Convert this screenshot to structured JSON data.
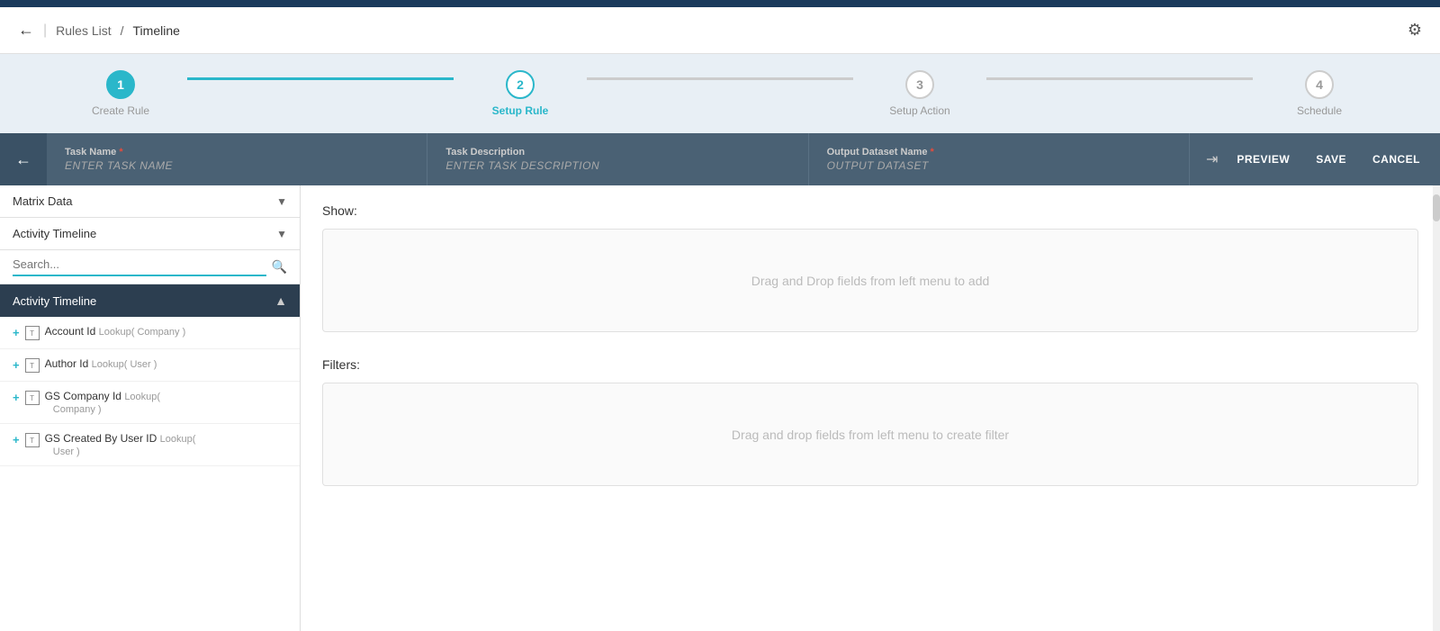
{
  "topNav": {
    "background": "#1a3a5c"
  },
  "breadcrumb": {
    "backLabel": "←",
    "rulesList": "Rules List",
    "separator": "/",
    "current": "Timeline",
    "gearIcon": "⚙"
  },
  "stepper": {
    "steps": [
      {
        "id": 1,
        "label": "Create Rule",
        "state": "active"
      },
      {
        "id": 2,
        "label": "Setup Rule",
        "state": "current"
      },
      {
        "id": 3,
        "label": "Setup Action",
        "state": "inactive"
      },
      {
        "id": 4,
        "label": "Schedule",
        "state": "inactive"
      }
    ]
  },
  "taskHeader": {
    "backIcon": "←",
    "taskNameLabel": "Task Name",
    "taskNameRequired": "*",
    "taskNamePlaceholder": "ENTER TASK NAME",
    "taskDescLabel": "Task Description",
    "taskDescPlaceholder": "ENTER TASK DESCRIPTION",
    "outputDatasetLabel": "Output Dataset Name",
    "outputDatasetRequired": "*",
    "outputDatasetPlaceholder": "OUTPUT DATASET",
    "previewLabel": "PREVIEW",
    "saveLabel": "SAVE",
    "cancelLabel": "CANCEL",
    "expandIcon": "⇥"
  },
  "sidebar": {
    "dropdown1Label": "Matrix Data",
    "dropdown2Label": "Activity Timeline",
    "searchPlaceholder": "Search...",
    "sectionHeader": "Activity Timeline",
    "items": [
      {
        "plus": "+",
        "iconLabel": "T",
        "name": "Account Id",
        "type": "Lookup( Company )"
      },
      {
        "plus": "+",
        "iconLabel": "T",
        "name": "Author Id",
        "type": "Lookup( User )"
      },
      {
        "plus": "+",
        "iconLabel": "T",
        "name": "GS Company Id",
        "type": "Lookup( Company )"
      },
      {
        "plus": "+",
        "iconLabel": "T",
        "name": "GS Created By User ID",
        "type": "Lookup( User )"
      }
    ]
  },
  "mainPanel": {
    "showLabel": "Show:",
    "showDropHint": "Drag and Drop fields from left menu to add",
    "filtersLabel": "Filters:",
    "filtersDropHint": "Drag and drop fields from left menu to create filter"
  }
}
